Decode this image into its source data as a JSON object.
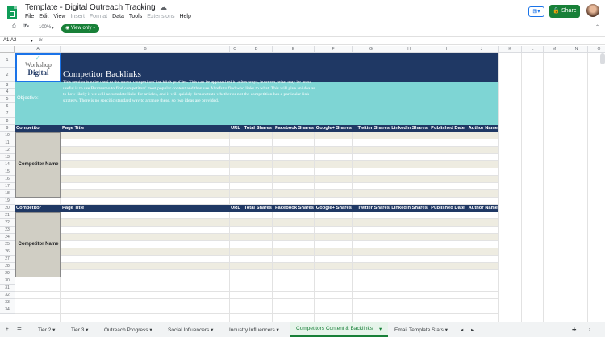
{
  "app": {
    "title": "Template - Digital Outreach Tracking",
    "menus": [
      "File",
      "Edit",
      "View",
      "Insert",
      "Format",
      "Data",
      "Tools",
      "Extensions",
      "Help"
    ],
    "disabled_menus": [
      "Insert",
      "Format",
      "Extensions"
    ],
    "share_label": "Share"
  },
  "toolbar": {
    "zoom": "100%",
    "view_only": "View only"
  },
  "formula": {
    "cell_ref": "A1:A2",
    "fx": "fx"
  },
  "columns": [
    "A",
    "B",
    "C",
    "D",
    "E",
    "F",
    "G",
    "H",
    "I",
    "J",
    "K",
    "L",
    "M",
    "N",
    "O"
  ],
  "rows": [
    "1",
    "2",
    "3",
    "4",
    "5",
    "6",
    "7",
    "8",
    "9",
    "10",
    "11",
    "12",
    "13",
    "14",
    "15",
    "16",
    "17",
    "18",
    "19",
    "20",
    "21",
    "22",
    "23",
    "24",
    "25",
    "26",
    "27",
    "28",
    "29",
    "30",
    "31",
    "32",
    "33",
    "34"
  ],
  "sheet": {
    "logo_line1": "Workshop",
    "logo_line2": "Digital",
    "title": "Competitor Backlinks",
    "objective_label": "Objective:",
    "objective_text": "This section is to be used to document competitors' backlink profiles. This can be approached in a few ways, however, what may be most useful is to use Buzzsumo to find competitors' most popular content and then use Ahrefs to find who links to what. This will give an idea as to how likely it we will accumulate links for articles, and it will quickly demonstrate whether or not the competition has a particular link strategy. There is no specific standard way to arrange these, so two ideas are provided.",
    "headers": [
      "Competitor",
      "Page Title",
      "URL",
      "Total Shares",
      "Facebook Shares",
      "Google+ Shares",
      "Twitter Shares",
      "LinkedIn Shares",
      "Published Date",
      "Author Name"
    ],
    "competitor_name": "Competitor Name"
  },
  "tabs": [
    "Tier 2",
    "Tier 3",
    "Outreach Progress",
    "Social Influencers",
    "Industry Influencers",
    "Competitors Content & Backlinks",
    "Email Template Stats"
  ],
  "active_tab": "Competitors Content & Backlinks",
  "colors": {
    "navy": "#1f3864",
    "teal": "#7ed5d4",
    "gray": "#d0cec4",
    "band": "#eeece1",
    "green": "#188038"
  }
}
